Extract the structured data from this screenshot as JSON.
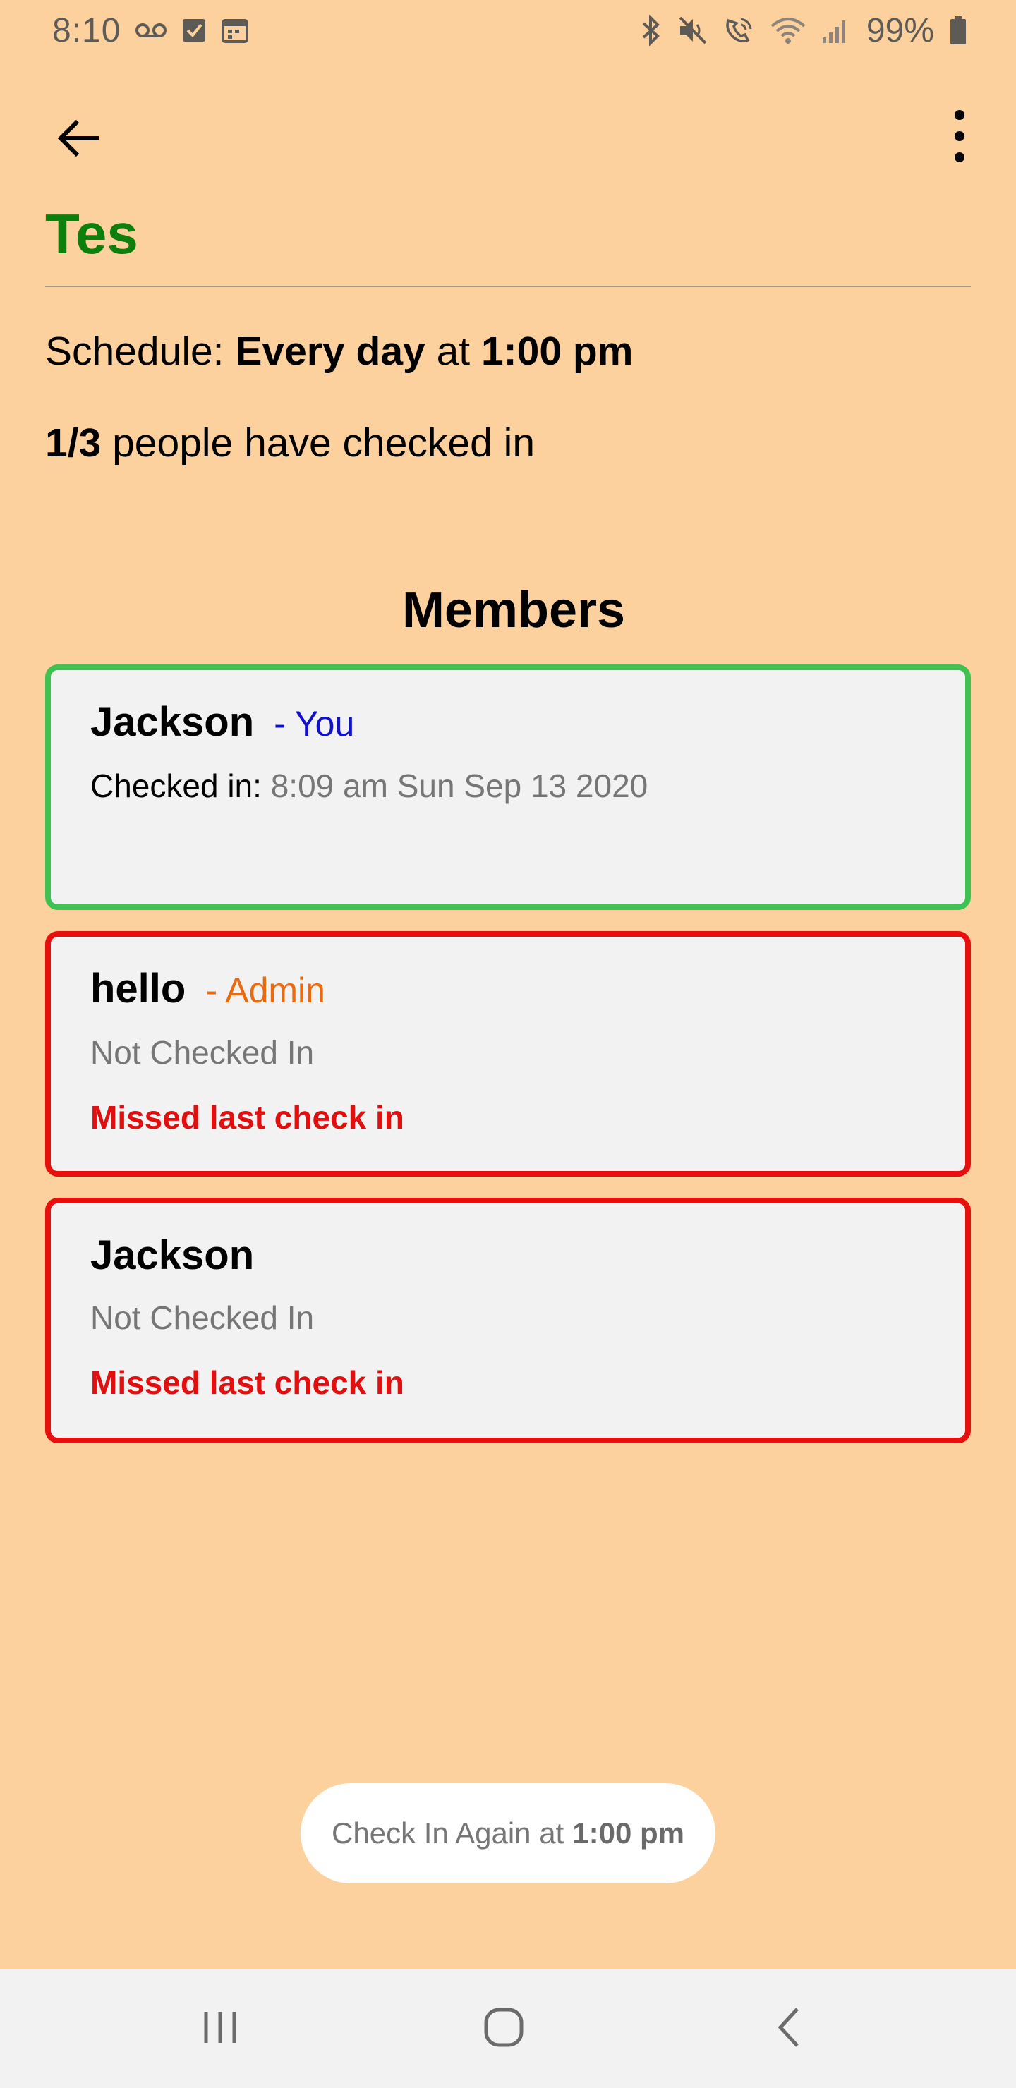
{
  "status_bar": {
    "time": "8:10",
    "battery_pct": "99%",
    "icons_left": [
      "voicemail-icon",
      "checkbox-icon",
      "calendar-icon"
    ],
    "icons_right": [
      "bluetooth-icon",
      "mute-icon",
      "wifi-calling-icon",
      "wifi-icon",
      "signal-icon",
      "battery-icon"
    ]
  },
  "toolbar": {
    "back_icon": "arrow-left-icon",
    "menu_icon": "more-vert-icon"
  },
  "group": {
    "title": "Tes",
    "title_color": "#0d7f0d",
    "schedule_prefix": "Schedule:",
    "schedule_days": "Every day",
    "schedule_at": "at",
    "schedule_time": "1:00 pm",
    "checked_count": "1/3",
    "checked_suffix": "people have checked in"
  },
  "members": {
    "heading": "Members",
    "items": [
      {
        "name": "Jackson",
        "role": "- You",
        "status_label": "Checked in:",
        "status_value": "8:09 am Sun Sep 13 2020",
        "border_color": "#3fc252"
      },
      {
        "name": "hello",
        "role": "- Admin",
        "status_value": "Not Checked In",
        "missed": "Missed last check in",
        "border_color": "#e80f0f"
      },
      {
        "name": "Jackson",
        "status_value": "Not Checked In",
        "missed": "Missed last check in",
        "border_color": "#e80f0f"
      }
    ]
  },
  "check_in_button": {
    "prefix": "Check In Again at",
    "time": "1:00 pm"
  },
  "nav_bar": {
    "recents_icon": "recents-icon",
    "home_icon": "home-icon",
    "back_icon": "nav-back-icon"
  },
  "colors": {
    "background": "#fdd19e",
    "card_background": "#f2f2f2",
    "missed_red": "#e30f0f",
    "you_blue": "#1010d0",
    "admin_orange": "#ea6a0f"
  }
}
